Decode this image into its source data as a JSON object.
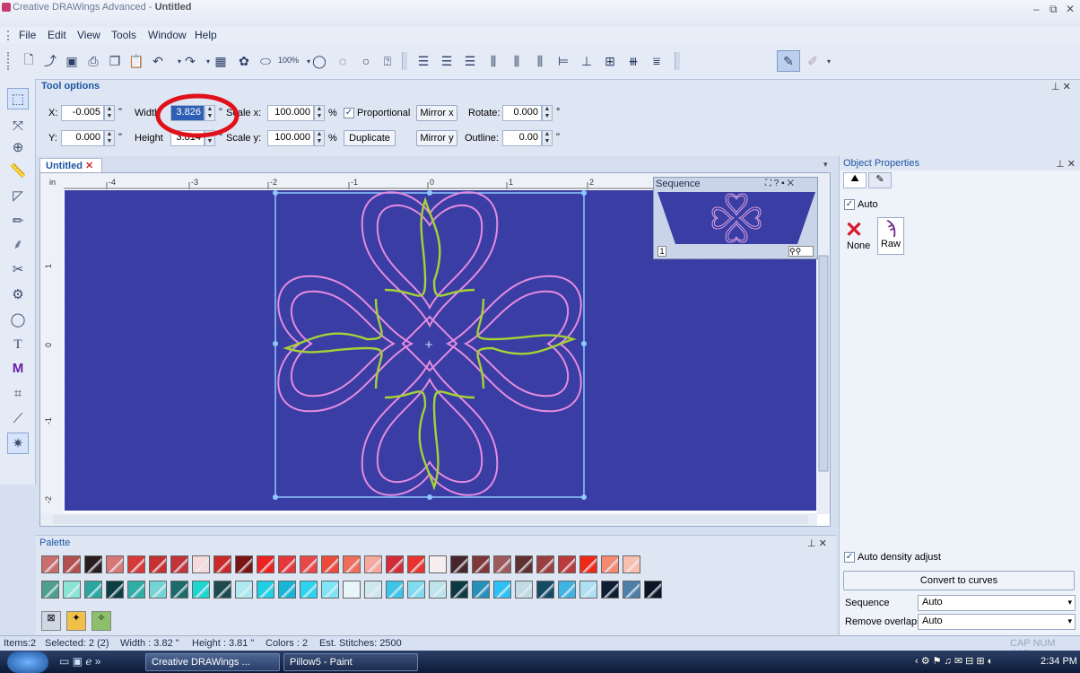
{
  "window": {
    "app_title": "Creative DRAWings Advanced",
    "doc_title": "Untitled",
    "title_separator": " - ",
    "minimize": "–",
    "maximize": "⧉",
    "close": "✕"
  },
  "menu": [
    "File",
    "Edit",
    "View",
    "Tools",
    "Window",
    "Help"
  ],
  "toolbar": {
    "zoom": "100%"
  },
  "tool_options": {
    "header": "Tool options",
    "x_label": "X:",
    "x_value": "-0.005",
    "y_label": "Y:",
    "y_value": "0.000",
    "unit": "\"",
    "width_label": "Width",
    "width_value": "3.826",
    "height_label": "Height",
    "height_value": "3.814",
    "scalex_label": "Scale x:",
    "scalex_value": "100.000",
    "scaley_label": "Scale y:",
    "scaley_value": "100.000",
    "percent": "%",
    "proportional_label": "Proportional",
    "proportional_checked": true,
    "duplicate_label": "Duplicate",
    "mirror_x_label": "Mirror x",
    "mirror_y_label": "Mirror y",
    "rotate_label": "Rotate:",
    "rotate_value": "0.000",
    "degree": "°",
    "outline_label": "Outline:",
    "outline_value": "0.00"
  },
  "document": {
    "tab_label": "Untitled",
    "ruler_unit": "in",
    "h_ruler_labels": [
      "-4",
      "-3",
      "-2",
      "-1",
      "0",
      "1",
      "2"
    ],
    "v_ruler_labels": [
      "1",
      "0",
      "-1",
      "-2"
    ],
    "canvas_color": "#3a3da3",
    "motif_outline_color": "#e58be0",
    "motif_fill_color": "#a6d236",
    "selection_color": "#8fc8ff"
  },
  "sequence_panel": {
    "title": "Sequence",
    "controls": "?",
    "item_number": "1"
  },
  "object_properties": {
    "title": "Object Properties",
    "auto_label": "Auto",
    "auto_checked": true,
    "none_label": "None",
    "raw_label": "Raw",
    "auto_density_label": "Auto density adjust",
    "auto_density_checked": true,
    "convert_button": "Convert to curves",
    "sequence_label": "Sequence",
    "sequence_value": "Auto",
    "remove_overlaps_label": "Remove overlaps",
    "remove_overlaps_value": "Auto"
  },
  "palette": {
    "title": "Palette",
    "row1": [
      "#c96d6d",
      "#b44f4f",
      "#2a1d1f",
      "#d87575",
      "#d83838",
      "#c73030",
      "#c3333a",
      "#f5d9dc",
      "#cc2a2a",
      "#7a1515",
      "#ee2020",
      "#e8373a",
      "#e84848",
      "#ec4b3a",
      "#ef6d5a",
      "#f7a89c",
      "#d42b3a",
      "#e8342e",
      "#f8eeee",
      "#45262a",
      "#7e3838",
      "#9e5b5b",
      "#5e3232",
      "#9b3e3e",
      "#bb3a3a",
      "#f02818",
      "#f58a70",
      "#f9c0b0"
    ],
    "row2": [
      "#4d9f8e",
      "#8ae4d6",
      "#29a7a0",
      "#0a3f43",
      "#2faea5",
      "#74d4d5",
      "#1d6a6b",
      "#1fd5d0",
      "#1c4a4e",
      "#aee8f0",
      "#1dd0e6",
      "#18b5d6",
      "#2dd4f0",
      "#7fe4f4",
      "#e8f6fa",
      "#cfe8ee",
      "#3dc4e8",
      "#80dbee",
      "#bde4ec",
      "#0e3844",
      "#2690b8",
      "#2cc0f5",
      "#c3dbe4",
      "#154a65",
      "#3fb3e2",
      "#aee0f3",
      "#0c1d34",
      "#4d7fa8",
      "#0a1628"
    ]
  },
  "status": {
    "items": "Items:2",
    "selected": "Selected: 2 (2)",
    "width": "Width : 3.82 \"",
    "height": "Height : 3.81 \"",
    "colors": "Colors : 2",
    "stitches": "Est. Stitches: 2500",
    "caps": "CAP NUM SCRL"
  },
  "taskbar": {
    "btn1": "Creative DRAWings ...",
    "btn2": "Pillow5 - Paint",
    "clock": "2:34 PM"
  }
}
